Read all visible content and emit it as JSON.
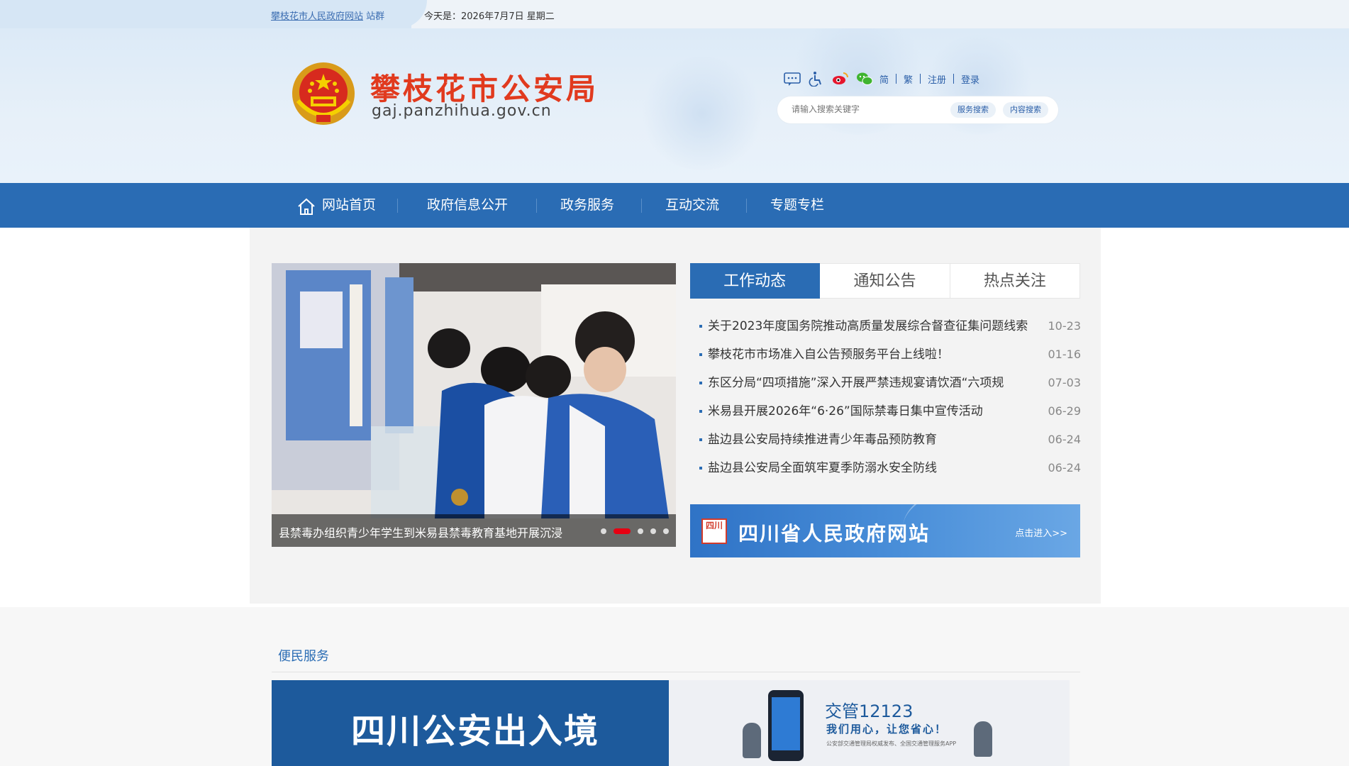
{
  "topbar": {
    "portal_link": "攀枝花市人民政府网站",
    "portal_suffix": "站群",
    "date_prefix": "今天是：",
    "date": "2026年7月7日 星期二"
  },
  "header": {
    "title": "攀枝花市公安局",
    "domain": "gaj.panzhihua.gov.cn",
    "tools": {
      "simplified": "简",
      "traditional": "繁",
      "register": "注册",
      "login": "登录"
    },
    "search": {
      "placeholder": "请输入搜索关键字",
      "service_search": "服务搜索",
      "content_search": "内容搜索"
    }
  },
  "nav": {
    "items": [
      "网站首页",
      "政府信息公开",
      "政务服务",
      "互动交流",
      "专题专栏"
    ]
  },
  "slider": {
    "caption": "县禁毒办组织青少年学生到米易县禁毒教育基地开展沉浸",
    "slide_count": 5,
    "active_slide": 2
  },
  "tabs": [
    "工作动态",
    "通知公告",
    "热点关注"
  ],
  "news": [
    {
      "title": "关于2023年度国务院推动高质量发展综合督查征集问题线索",
      "date": "10-23"
    },
    {
      "title": "攀枝花市市场准入自公告预服务平台上线啦！",
      "date": "01-16"
    },
    {
      "title": "东区分局“四项措施”深入开展严禁违规宴请饮酒“六项规",
      "date": "07-03"
    },
    {
      "title": "米易县开展2026年“6·26”国际禁毒日集中宣传活动",
      "date": "06-29"
    },
    {
      "title": "盐边县公安局持续推进青少年毒品预防教育",
      "date": "06-24"
    },
    {
      "title": "盐边县公安局全面筑牢夏季防溺水安全防线",
      "date": "06-24"
    }
  ],
  "banner": {
    "logo_text": "四川",
    "title": "四川省人民政府网站",
    "enter": "点击进入>>"
  },
  "services": {
    "title": "便民服务",
    "card1": "四川公安出入境",
    "card2_title": "交管12123",
    "card2_sub": "我们用心，让您省心！",
    "card2_small": "公安部交通管理局权威发布、全国交通管理服务APP"
  },
  "colors": {
    "nav": "#2a6cb4",
    "title_red": "#e13a1e",
    "dot_active": "#e60012"
  }
}
